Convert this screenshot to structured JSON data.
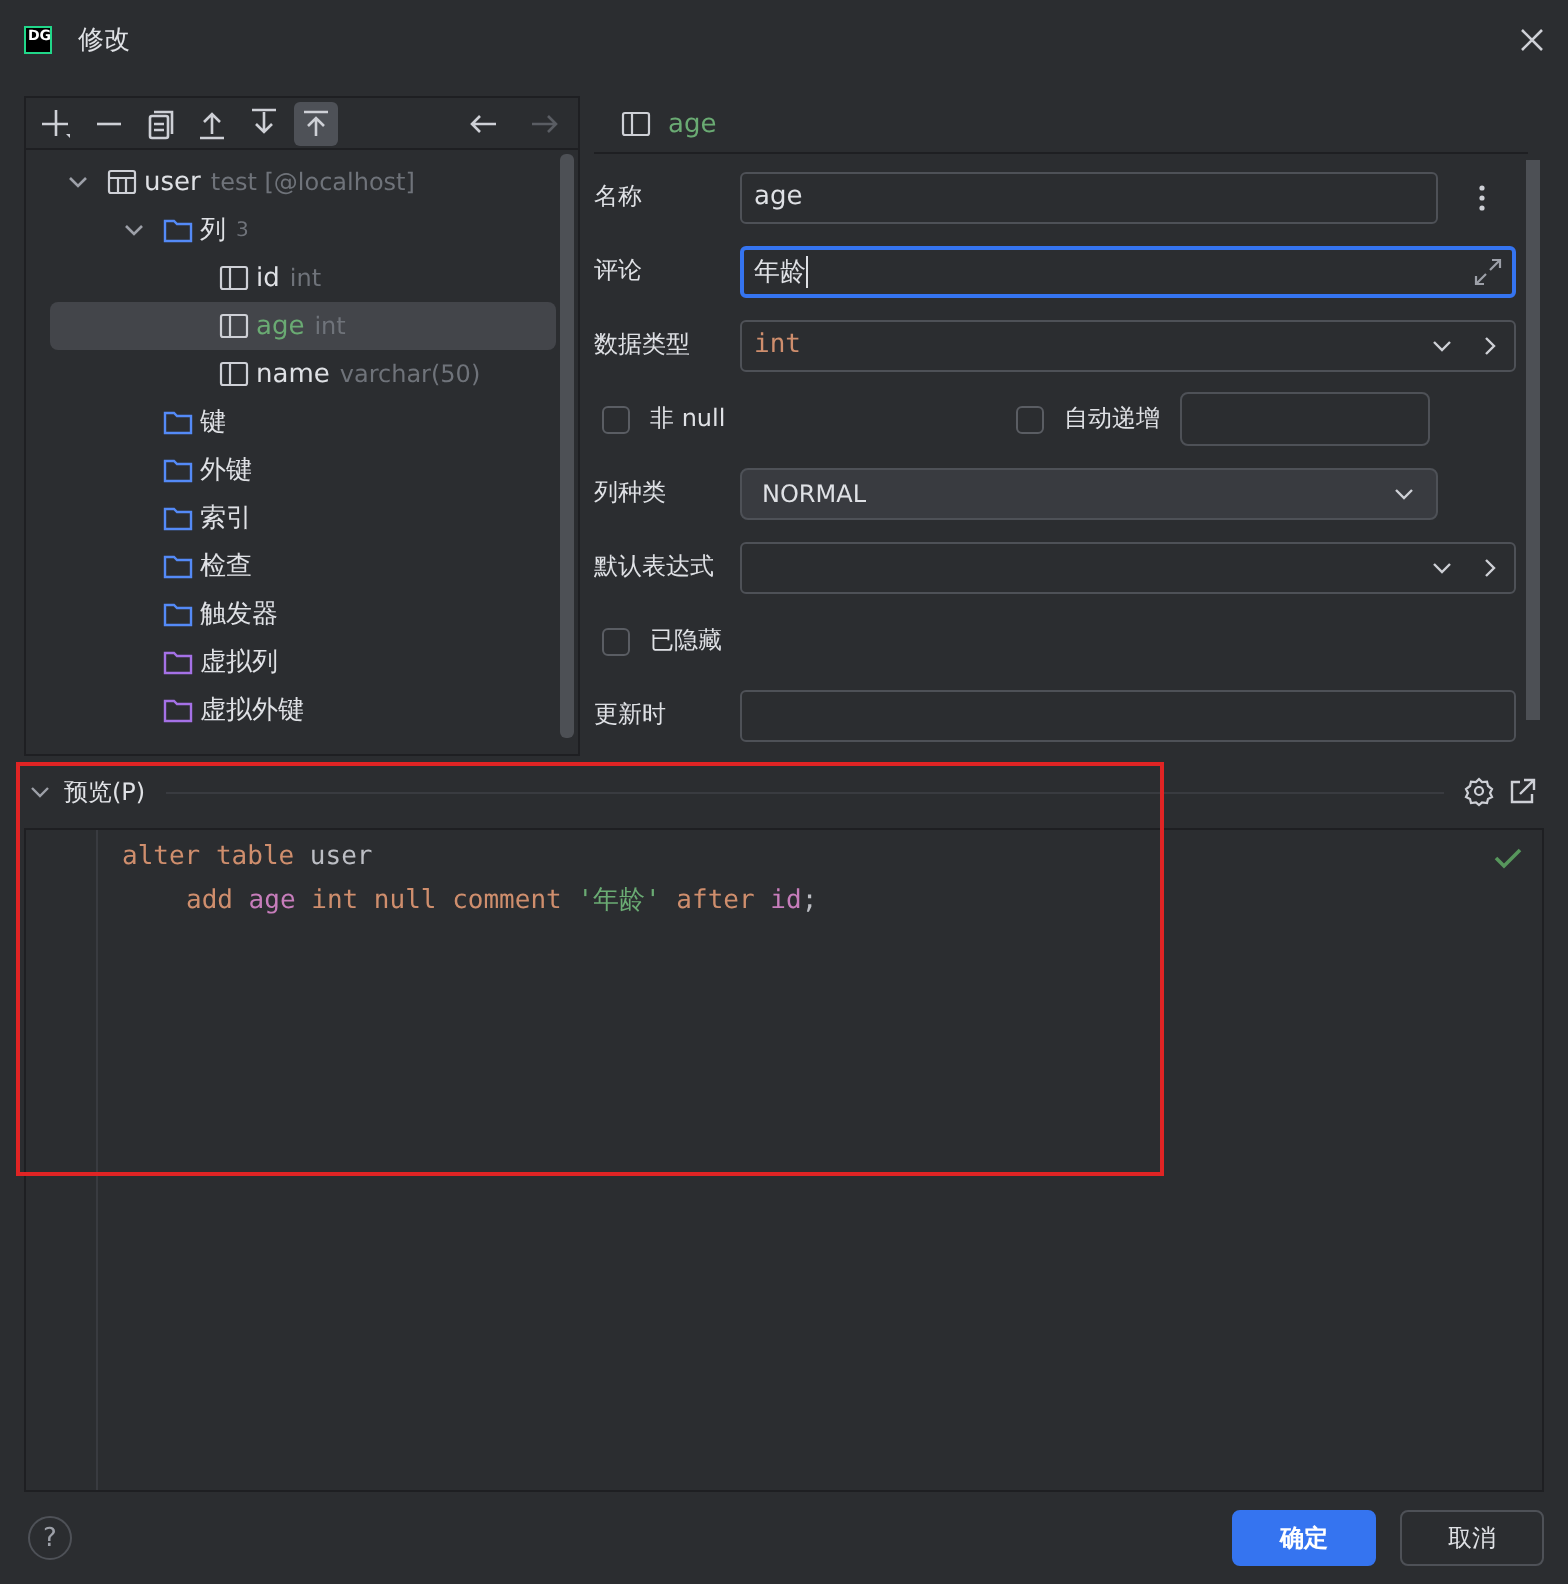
{
  "window": {
    "title": "修改",
    "logo": "DG"
  },
  "toolbar": {
    "buttons": [
      {
        "kind": "add",
        "selected": false
      },
      {
        "kind": "remove",
        "selected": false
      },
      {
        "kind": "copy",
        "selected": false
      },
      {
        "kind": "up",
        "selected": false
      },
      {
        "kind": "down",
        "selected": false
      },
      {
        "kind": "top",
        "selected": true
      }
    ],
    "nav": [
      {
        "kind": "back",
        "disabled": false
      },
      {
        "kind": "forward",
        "disabled": true
      }
    ]
  },
  "tree": [
    {
      "kind": "table",
      "label": "user",
      "detail": "test [@localhost]",
      "expanded": true,
      "selected": false,
      "children": [
        {
          "kind": "folder",
          "label": "列",
          "detail": "3",
          "expanded": true,
          "selected": false,
          "children": [
            {
              "kind": "column",
              "label": "id",
              "detail": "int",
              "selected": false
            },
            {
              "kind": "column",
              "label": "age",
              "detail": "int",
              "selected": true
            },
            {
              "kind": "column",
              "label": "name",
              "detail": "varchar(50)",
              "selected": false
            }
          ]
        },
        {
          "kind": "folder",
          "label": "键",
          "selected": false
        },
        {
          "kind": "folder",
          "label": "外键",
          "selected": false
        },
        {
          "kind": "folder",
          "label": "索引",
          "selected": false
        },
        {
          "kind": "folder",
          "label": "检查",
          "selected": false
        },
        {
          "kind": "folder",
          "label": "触发器",
          "selected": false
        },
        {
          "kind": "virtual-folder",
          "label": "虚拟列",
          "selected": false
        },
        {
          "kind": "virtual-folder",
          "label": "虚拟外键",
          "selected": false
        }
      ]
    }
  ],
  "form": {
    "header": "age",
    "fields": [
      {
        "kind": "text",
        "label": "名称",
        "value": "age",
        "focused": false,
        "menu": true
      },
      {
        "kind": "text",
        "label": "评论",
        "value": "年龄",
        "focused": true,
        "expand": true
      },
      {
        "kind": "combo",
        "label": "数据类型",
        "value": "int"
      },
      {
        "kind": "checks",
        "checks": [
          {
            "label": "非 null",
            "checked": false
          },
          {
            "label": "自动递增",
            "checked": false
          }
        ]
      },
      {
        "kind": "select",
        "label": "列种类",
        "value": "NORMAL"
      },
      {
        "kind": "combo",
        "label": "默认表达式"
      },
      {
        "kind": "check",
        "label": "已隐藏",
        "checked": false
      },
      {
        "kind": "text",
        "label": "更新时",
        "focused": false
      }
    ]
  },
  "preview": {
    "title": "预览(P)",
    "expanded": true,
    "valid": true,
    "lines": [
      {
        "indent": false,
        "tokens": [
          {
            "kind": "keyword",
            "text": "alter"
          },
          {
            "kind": "keyword",
            "text": "table"
          },
          {
            "kind": "name",
            "text": "user"
          }
        ]
      },
      {
        "indent": true,
        "tokens": [
          {
            "kind": "keyword",
            "text": "add"
          },
          {
            "kind": "column",
            "text": "age"
          },
          {
            "kind": "keyword",
            "text": "int"
          },
          {
            "kind": "keyword",
            "text": "null"
          },
          {
            "kind": "keyword",
            "text": "comment"
          },
          {
            "kind": "string",
            "text": "'年龄'"
          },
          {
            "kind": "keyword",
            "text": "after"
          },
          {
            "kind": "column",
            "text": "id"
          },
          {
            "kind": "punct",
            "text": ";"
          }
        ]
      }
    ]
  },
  "footer": {
    "help": "?",
    "buttons": [
      {
        "label": "确定",
        "primary": true
      },
      {
        "label": "取消",
        "primary": false
      }
    ]
  }
}
